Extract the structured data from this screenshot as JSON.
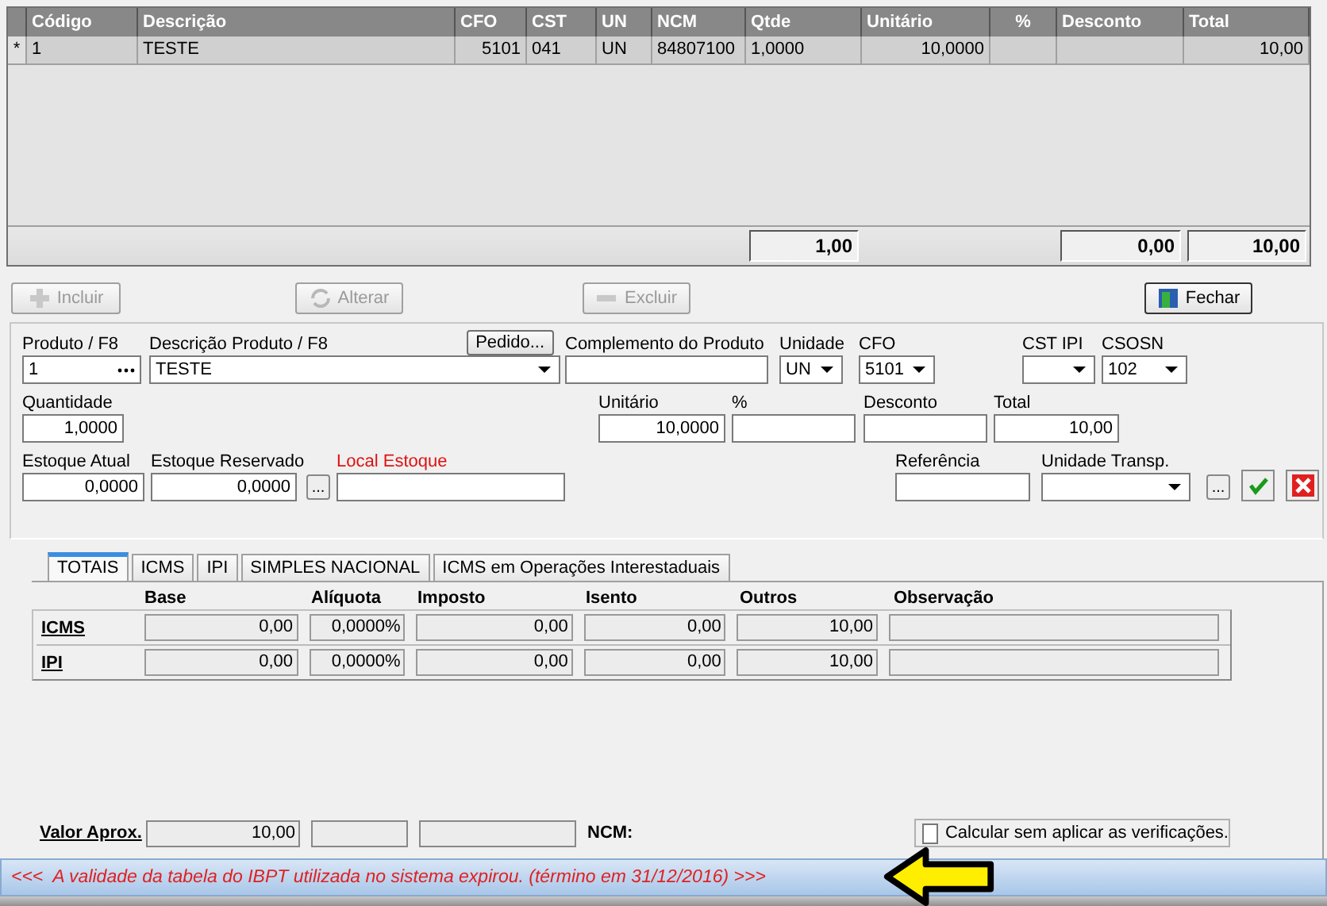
{
  "grid": {
    "columns": [
      {
        "label": "Código"
      },
      {
        "label": "Descrição"
      },
      {
        "label": "CFO"
      },
      {
        "label": "CST"
      },
      {
        "label": "UN"
      },
      {
        "label": "NCM"
      },
      {
        "label": "Qtde",
        "total": "1,00"
      },
      {
        "label": "Unitário"
      },
      {
        "label": "%"
      },
      {
        "label": "Desconto",
        "total": "0,00"
      },
      {
        "label": "Total",
        "total": "10,00"
      }
    ],
    "rows": [
      {
        "marker": "*",
        "cells": [
          "1",
          "TESTE",
          "5101",
          "041",
          "UN",
          "84807100",
          "1,0000",
          "10,0000",
          "",
          "",
          "10,00"
        ]
      }
    ]
  },
  "actions": [
    {
      "label": "Incluir",
      "kind": "add",
      "disabled": true
    },
    {
      "label": "Alterar",
      "kind": "refresh",
      "disabled": true
    },
    {
      "label": "Excluir",
      "kind": "remove",
      "disabled": true
    },
    {
      "label": "Fechar",
      "kind": "door",
      "disabled": false
    }
  ],
  "form": {
    "lines": [
      {
        "fields": [
          {
            "kind": "lookup",
            "label": "Produto / F8",
            "value": "1",
            "required": false
          },
          {
            "kind": "dropdown",
            "label": "Descrição Produto / F8",
            "value": "TESTE",
            "button": "Pedido...",
            "required": false
          },
          {
            "kind": "text",
            "label": "Complemento do Produto",
            "required": false
          },
          {
            "kind": "dropdown",
            "label": "Unidade",
            "value": "UN",
            "required": false
          },
          {
            "kind": "dropdown",
            "label": "CFO",
            "value": "5101",
            "required": false
          },
          {
            "kind": "dropdown",
            "label": "CST IPI",
            "required": false
          },
          {
            "kind": "dropdown",
            "label": "CSOSN",
            "value": "102",
            "required": false
          }
        ]
      },
      {
        "fields": [
          {
            "kind": "number",
            "label": "Quantidade",
            "value": "1,0000",
            "required": false
          },
          {
            "kind": "number",
            "label": "Unitário",
            "value": "10,0000",
            "required": false
          },
          {
            "kind": "number",
            "label": "%",
            "required": false
          },
          {
            "kind": "number",
            "label": "Desconto",
            "required": false
          },
          {
            "kind": "number",
            "label": "Total",
            "value": "10,00",
            "required": false
          }
        ]
      },
      {
        "fields": [
          {
            "kind": "number",
            "label": "Estoque Atual",
            "value": "0,0000",
            "required": false
          },
          {
            "kind": "number",
            "label": "Estoque Reservado",
            "value": "0,0000",
            "required": false
          },
          {
            "kind": "button",
            "value": "..."
          },
          {
            "kind": "text",
            "label": "Local Estoque",
            "required": true
          },
          {
            "kind": "text",
            "label": "Referência",
            "required": false
          },
          {
            "kind": "dropdown",
            "label": "Unidade Transp.",
            "required": false
          },
          {
            "kind": "button",
            "value": "..."
          },
          {
            "kind": "confirm"
          },
          {
            "kind": "cancel"
          }
        ]
      }
    ]
  },
  "tabs": [
    {
      "label": "TOTAIS",
      "selected": true
    },
    {
      "label": "ICMS",
      "selected": false
    },
    {
      "label": "IPI",
      "selected": false
    },
    {
      "label": "SIMPLES NACIONAL",
      "selected": false
    },
    {
      "label": "ICMS em Operações Interestaduais",
      "selected": false
    }
  ],
  "taxes": {
    "columns": [
      "Base",
      "Alíquota",
      "Imposto",
      "Isento",
      "Outros",
      "Observação"
    ],
    "rows": [
      {
        "name": "ICMS",
        "values": [
          "0,00",
          "0,0000%",
          "0,00",
          "0,00",
          "10,00"
        ]
      },
      {
        "name": "IPI",
        "values": [
          "0,00",
          "0,0000%",
          "0,00",
          "0,00",
          "10,00"
        ]
      }
    ]
  },
  "approx": {
    "label": "Valor Aprox.",
    "value": "10,00",
    "ncm_label": "NCM:"
  },
  "checkbox": {
    "label": "Calcular sem aplicar as verificações.",
    "checked": false
  },
  "status": {
    "message": "<<<  A validade da tabela do IBPT utilizada no sistema expirou. (término em 31/12/2016) >>>"
  }
}
